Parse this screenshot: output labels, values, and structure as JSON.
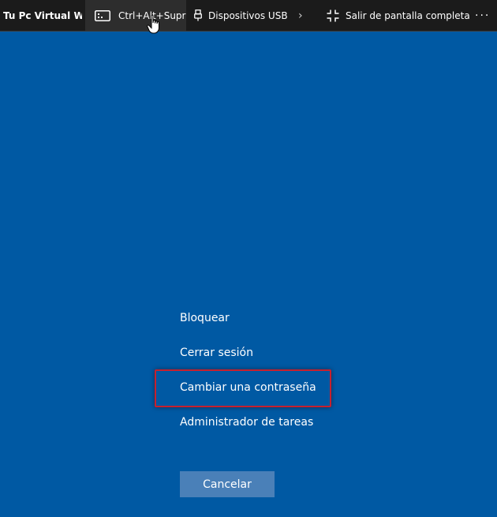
{
  "toolbar": {
    "title": "Tu Pc Virtual W...",
    "ctrl_alt_del_label": "Ctrl+Alt+Supr",
    "usb_label": "Dispositivos USB",
    "chevron": "›",
    "fullscreen_label": "Salir de pantalla completa",
    "more": "···"
  },
  "security_menu": {
    "items": [
      {
        "label": "Bloquear"
      },
      {
        "label": "Cerrar sesión"
      },
      {
        "label": "Cambiar una contraseña"
      },
      {
        "label": "Administrador de tareas"
      }
    ],
    "cancel_label": "Cancelar",
    "highlighted_item": "Cambiar una contraseña"
  },
  "colors": {
    "background": "#0059a3",
    "toolbar": "#1b1b1b",
    "highlight_border": "#c8202e",
    "cancel_button": "#4a80b8"
  },
  "icons": [
    "keyboard-icon",
    "usb-icon",
    "chevron-right-icon",
    "exit-fullscreen-icon",
    "more-icon",
    "hand-cursor-icon"
  ]
}
